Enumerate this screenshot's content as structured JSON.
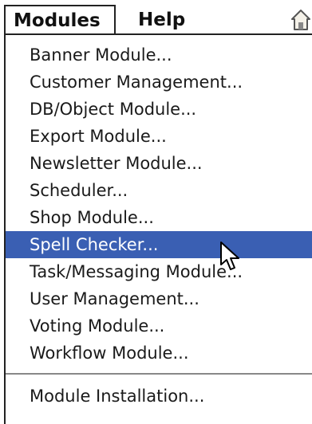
{
  "menubar": {
    "modules_label": "Modules",
    "help_label": "Help",
    "home_icon": "home-icon"
  },
  "dropdown": {
    "items": [
      {
        "label": "Banner Module..."
      },
      {
        "label": "Customer Management..."
      },
      {
        "label": "DB/Object Module..."
      },
      {
        "label": "Export Module..."
      },
      {
        "label": "Newsletter Module..."
      },
      {
        "label": "Scheduler..."
      },
      {
        "label": "Shop Module..."
      },
      {
        "label": "Spell Checker...",
        "selected": true
      },
      {
        "label": "Task/Messaging Module..."
      },
      {
        "label": "User Management..."
      },
      {
        "label": "Voting Module..."
      },
      {
        "label": "Workflow Module..."
      }
    ],
    "footer_items": [
      {
        "label": "Module Installation..."
      }
    ],
    "selection_color": "#3a5fb3"
  }
}
